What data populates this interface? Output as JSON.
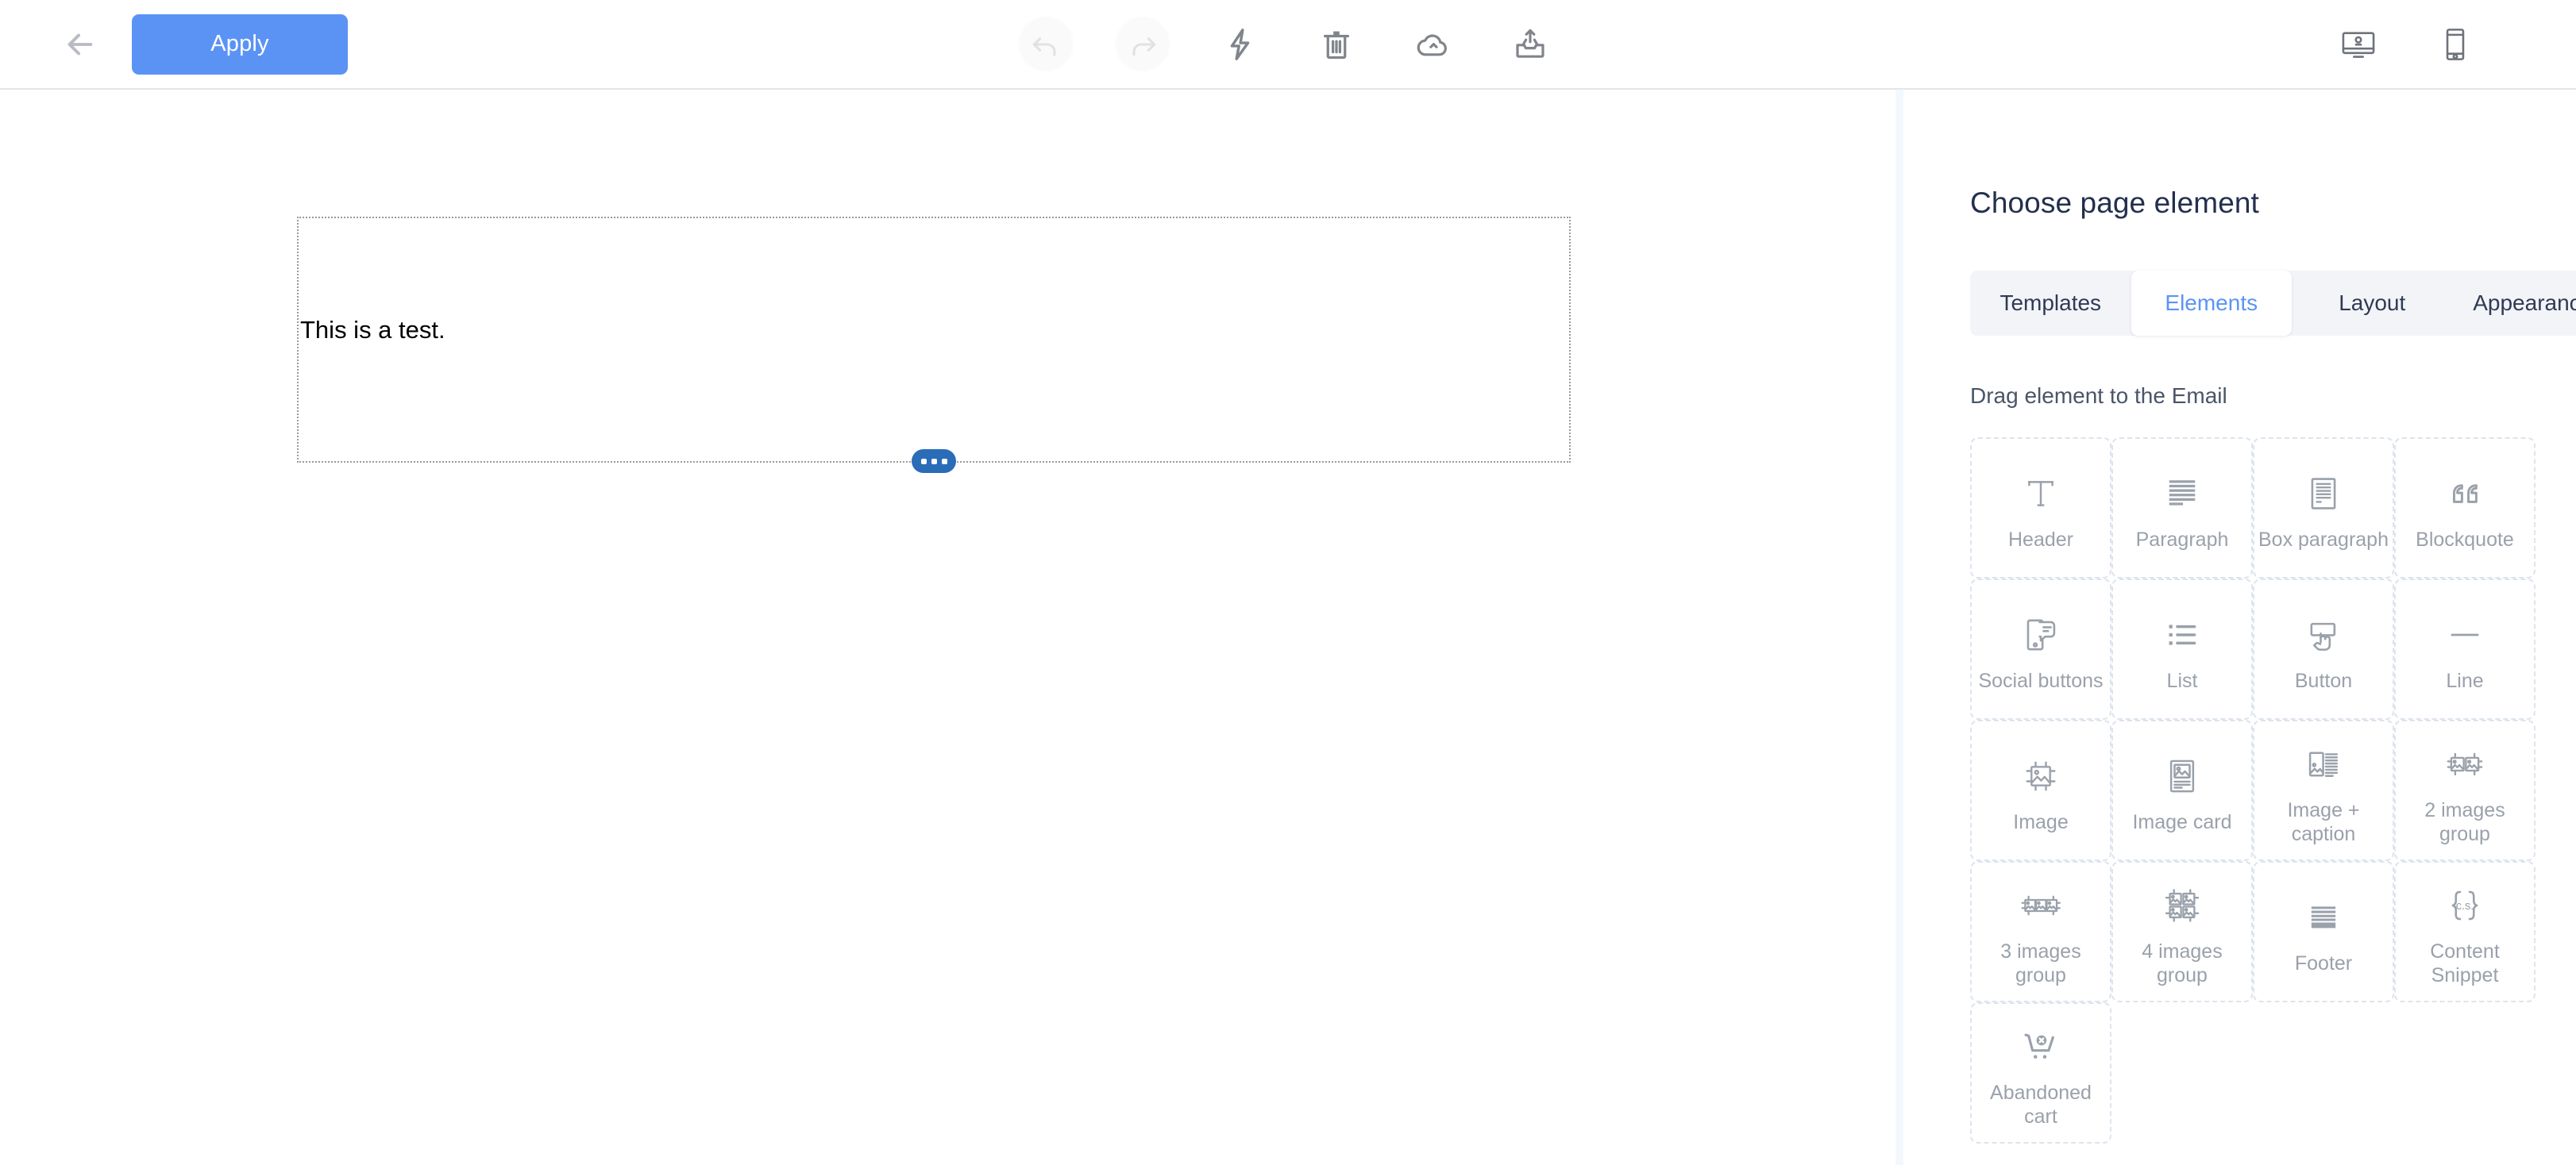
{
  "toolbar": {
    "back_label": "back-arrow",
    "apply_label": "Apply",
    "center_icons": [
      {
        "name": "undo-icon",
        "disabled": true
      },
      {
        "name": "redo-icon",
        "disabled": true
      },
      {
        "name": "lightning-icon",
        "disabled": false
      },
      {
        "name": "trash-icon",
        "disabled": false
      },
      {
        "name": "cloud-upload-icon",
        "disabled": false
      },
      {
        "name": "tray-export-icon",
        "disabled": false
      }
    ],
    "right_icons": [
      {
        "name": "desktop-preview-icon"
      },
      {
        "name": "mobile-preview-icon"
      }
    ]
  },
  "canvas": {
    "block_text": "This is a test.",
    "handle_icon": "more-dots-handle"
  },
  "panel": {
    "title": "Choose page element",
    "tabs": [
      {
        "label": "Templates",
        "active": false
      },
      {
        "label": "Elements",
        "active": true
      },
      {
        "label": "Layout",
        "active": false
      },
      {
        "label": "Appearance",
        "active": false
      }
    ],
    "drag_hint": "Drag element to the Email",
    "elements": [
      {
        "label": "Header",
        "icon": "text-header-icon"
      },
      {
        "label": "Paragraph",
        "icon": "paragraph-lines-icon"
      },
      {
        "label": "Box paragraph",
        "icon": "box-paragraph-icon"
      },
      {
        "label": "Blockquote",
        "icon": "quotation-marks-icon"
      },
      {
        "label": "Social buttons",
        "icon": "social-bubble-icon"
      },
      {
        "label": "List",
        "icon": "bullet-list-icon"
      },
      {
        "label": "Button",
        "icon": "click-button-icon"
      },
      {
        "label": "Line",
        "icon": "horizontal-line-icon"
      },
      {
        "label": "Image",
        "icon": "image-crop-icon"
      },
      {
        "label": "Image card",
        "icon": "image-card-icon"
      },
      {
        "label": "Image + caption",
        "icon": "image-caption-icon"
      },
      {
        "label": "2 images group",
        "icon": "two-images-icon"
      },
      {
        "label": "3 images group",
        "icon": "three-images-icon"
      },
      {
        "label": "4 images group",
        "icon": "four-images-icon"
      },
      {
        "label": "Footer",
        "icon": "footer-icon"
      },
      {
        "label": "Content Snippet",
        "icon": "content-snippet-icon"
      },
      {
        "label": "Abandoned cart",
        "icon": "abandoned-cart-icon"
      }
    ]
  },
  "colors": {
    "accent_blue": "#5b93f5",
    "tab_active_text": "#5b93f5",
    "title_navy": "#232f4e",
    "handle_blue": "#2b6cb8",
    "icon_gray": "#8e949d",
    "card_border": "#dde4ee"
  }
}
